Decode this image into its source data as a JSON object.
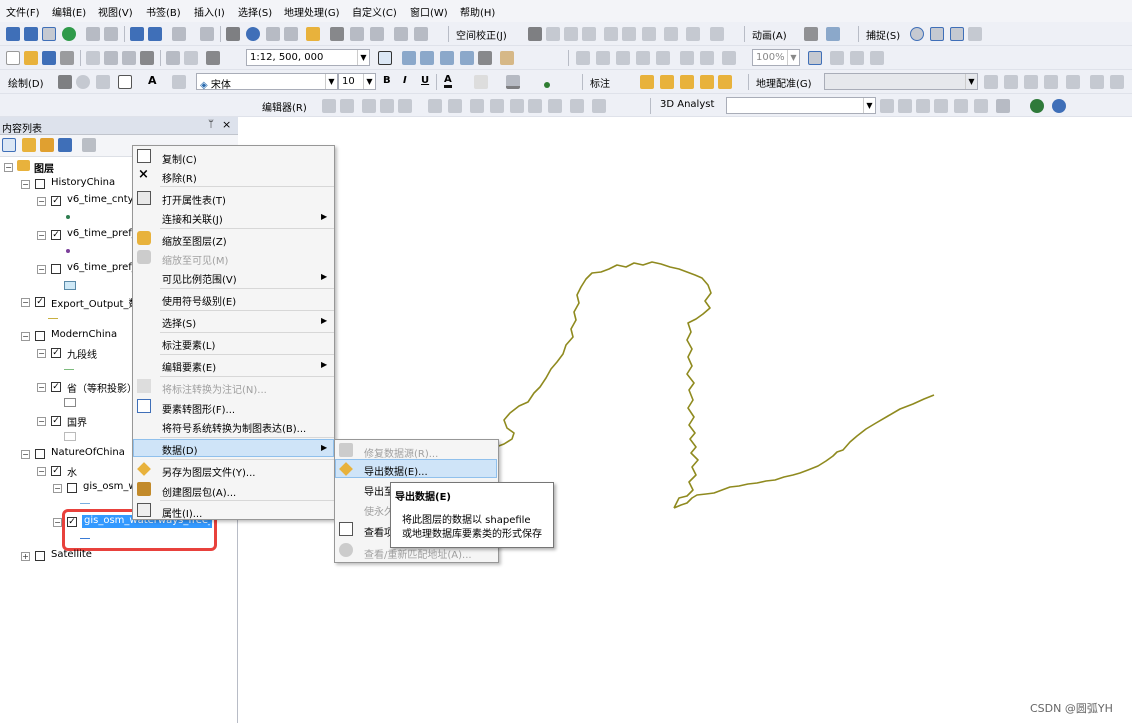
{
  "menubar": [
    "文件(F)",
    "编辑(E)",
    "视图(V)",
    "书签(B)",
    "插入(I)",
    "选择(S)",
    "地理处理(G)",
    "自定义(C)",
    "窗口(W)",
    "帮助(H)"
  ],
  "toolbar1": {
    "animation": "动画(A)",
    "spatial_adjust": "空间校正(J)",
    "snapping": "捕捉(S)"
  },
  "toolbar2": {
    "scale": "1:12, 500, 000",
    "zoom": "100%"
  },
  "toolbar3": {
    "draw": "绘制(D)",
    "font": "宋体",
    "font_size": "10",
    "bold": "B",
    "italic": "I",
    "underline": "U",
    "label": "标注",
    "georef": "地理配准(G)"
  },
  "toolbar4": {
    "editor": "编辑器(R)",
    "analyst": "3D Analyst"
  },
  "toc": {
    "title": "内容列表",
    "pin": "ᛘ",
    "close": "×",
    "rows": [
      {
        "text": "图层"
      },
      {
        "text": "HistoryChina"
      },
      {
        "text": "v6_time_cnty_"
      },
      {
        "text": "v6_time_pref_"
      },
      {
        "text": "v6_time_pref_"
      },
      {
        "text": "Export_Output_数"
      },
      {
        "text": "ModernChina"
      },
      {
        "text": "九段线"
      },
      {
        "text": "省（等积投影）"
      },
      {
        "text": "国界"
      },
      {
        "text": "NatureOfChina"
      },
      {
        "text": "水"
      },
      {
        "text": "gis_osm_w"
      },
      {
        "text": "gis_osm_waterways_free_1"
      },
      {
        "text": "Satellite"
      }
    ]
  },
  "context_menu": {
    "items": [
      "复制(C)",
      "移除(R)",
      "打开属性表(T)",
      "连接和关联(J)",
      "缩放至图层(Z)",
      "缩放至可见(M)",
      "可见比例范围(V)",
      "使用符号级别(E)",
      "选择(S)",
      "标注要素(L)",
      "编辑要素(E)",
      "将标注转换为注记(N)...",
      "要素转图形(F)...",
      "将符号系统转换为制图表达(B)...",
      "数据(D)",
      "另存为图层文件(Y)...",
      "创建图层包(A)...",
      "属性(I)..."
    ]
  },
  "submenu": {
    "items": [
      "修复数据源(R)...",
      "导出数据(E)...",
      "导出至",
      "使永久",
      "查看项",
      "查看/重新匹配地址(A)..."
    ]
  },
  "tooltip": {
    "title": "导出数据(E)",
    "line1": "将此图层的数据以 shapefile",
    "line2": "或地理数据库要素类的形式保存"
  },
  "watermark": "CSDN @圆弧YH",
  "colors": {
    "selection": "#3399ff",
    "highlight_box": "#e8413c",
    "river": "#8f8a1f"
  }
}
